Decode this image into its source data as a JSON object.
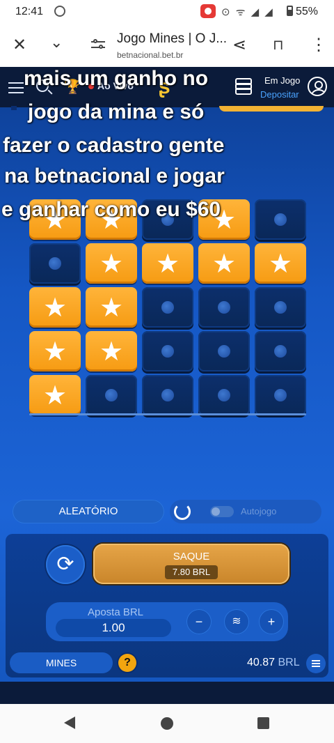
{
  "status_bar": {
    "time": "12:41",
    "battery": "55%"
  },
  "browser": {
    "close_icon": "close-icon",
    "title": "Jogo Mines | O J...",
    "url": "betnacional.bet.br"
  },
  "header": {
    "live_label": "Ao Vivo",
    "account_label": "Em Jogo",
    "deposit_label": "Depositar"
  },
  "caption_lines": [
    "mais um ganho no",
    "jogo da mina e só",
    "fazer o cadastro gente",
    "na betnacional e jogar",
    "e ganhar como eu $60"
  ],
  "grid": [
    [
      "star",
      "star",
      "hidden",
      "star",
      "hidden"
    ],
    [
      "hidden",
      "star",
      "star",
      "star",
      "star"
    ],
    [
      "star",
      "star",
      "hidden",
      "hidden",
      "hidden"
    ],
    [
      "star",
      "star",
      "hidden",
      "hidden",
      "hidden"
    ],
    [
      "star",
      "hidden",
      "hidden",
      "hidden",
      "hidden"
    ]
  ],
  "controls": {
    "random_label": "ALEATÓRIO",
    "autoplay_label": "Autojogo",
    "autoplay_on": false,
    "cashout_label": "SAQUE",
    "cashout_amount": "7.80 BRL",
    "bet_label": "Aposta BRL",
    "bet_value": "1.00",
    "minus": "−",
    "plus": "+"
  },
  "footer": {
    "game_label": "MINES",
    "help": "?",
    "balance": "40.87",
    "currency": "BRL"
  },
  "colors": {
    "star_tile": "#f69b12",
    "hidden_tile": "#0a2858",
    "accent": "#f2b233"
  }
}
